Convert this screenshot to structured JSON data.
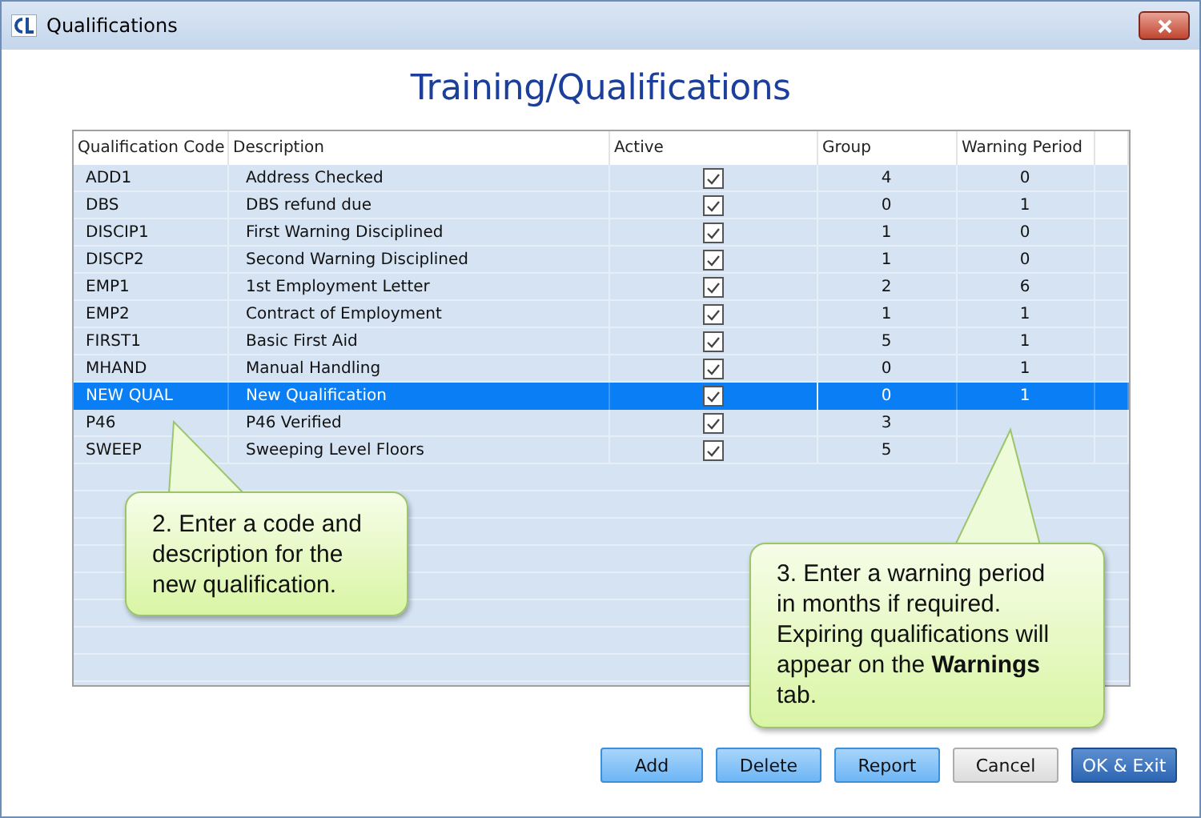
{
  "window": {
    "title": "Qualifications"
  },
  "heading": "Training/Qualifications",
  "table": {
    "columns": [
      "Qualification Code",
      "Description",
      "Active",
      "Group",
      "Warning Period"
    ],
    "rows": [
      {
        "code": "ADD1",
        "description": "Address Checked",
        "active": true,
        "group": "4",
        "warning": "0",
        "selected": false
      },
      {
        "code": "DBS",
        "description": "DBS refund due",
        "active": true,
        "group": "0",
        "warning": "1",
        "selected": false
      },
      {
        "code": "DISCIP1",
        "description": "First Warning Disciplined",
        "active": true,
        "group": "1",
        "warning": "0",
        "selected": false
      },
      {
        "code": "DISCP2",
        "description": "Second Warning Disciplined",
        "active": true,
        "group": "1",
        "warning": "0",
        "selected": false
      },
      {
        "code": "EMP1",
        "description": "1st Employment Letter",
        "active": true,
        "group": "2",
        "warning": "6",
        "selected": false
      },
      {
        "code": "EMP2",
        "description": "Contract of Employment",
        "active": true,
        "group": "1",
        "warning": "1",
        "selected": false
      },
      {
        "code": "FIRST1",
        "description": "Basic First Aid",
        "active": true,
        "group": "5",
        "warning": "1",
        "selected": false
      },
      {
        "code": "MHAND",
        "description": "Manual Handling",
        "active": true,
        "group": "0",
        "warning": "1",
        "selected": false
      },
      {
        "code": "NEW QUAL",
        "description": "New Qualification",
        "active": true,
        "group": "0",
        "warning": "1",
        "selected": true
      },
      {
        "code": "P46",
        "description": "P46 Verified",
        "active": true,
        "group": "3",
        "selected": false
      },
      {
        "code": "SWEEP",
        "description": "Sweeping Level Floors",
        "active": true,
        "group": "5",
        "selected": false
      }
    ]
  },
  "callouts": [
    {
      "text": "2. Enter a code and description for the new qualification."
    },
    {
      "text": "3. Enter a warning period in months if required. Expiring qualifications will appear on the **Warnings** tab."
    }
  ],
  "buttons": [
    {
      "label": "Add",
      "kind": "action"
    },
    {
      "label": "Delete",
      "kind": "action"
    },
    {
      "label": "Report",
      "kind": "action"
    },
    {
      "label": "Cancel",
      "kind": "plain"
    },
    {
      "label": "OK & Exit",
      "kind": "default"
    }
  ]
}
